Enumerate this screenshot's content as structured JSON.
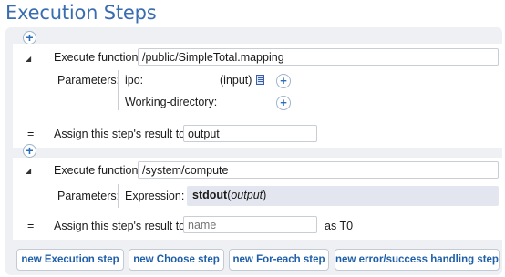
{
  "page": {
    "title": "Execution Steps"
  },
  "icons": {
    "add": "+",
    "collapse": "◢"
  },
  "step1": {
    "execute_label": "Execute function",
    "function_path": "/public/SimpleTotal.mapping",
    "parameters_label": "Parameters:",
    "params": [
      {
        "name": "ipo:",
        "value": "(input)"
      },
      {
        "name": "Working-directory:",
        "value": ""
      }
    ],
    "assign_symbol": "=",
    "assign_label": "Assign this step's result to",
    "assign_value": "output"
  },
  "step2": {
    "execute_label": "Execute function",
    "function_path": "/system/compute",
    "parameters_label": "Parameters:",
    "expression_label": "Expression:",
    "expression_func": "stdout",
    "expression_open": "(",
    "expression_arg": "output",
    "expression_close": ")",
    "assign_symbol": "=",
    "assign_label": "Assign this step's result to",
    "assign_placeholder": "name",
    "assign_suffix": "as T0"
  },
  "buttons": {
    "new_execution": "new Execution step",
    "new_choose": "new Choose step",
    "new_foreach": "new For-each step",
    "new_error": "new error/success handling step"
  }
}
